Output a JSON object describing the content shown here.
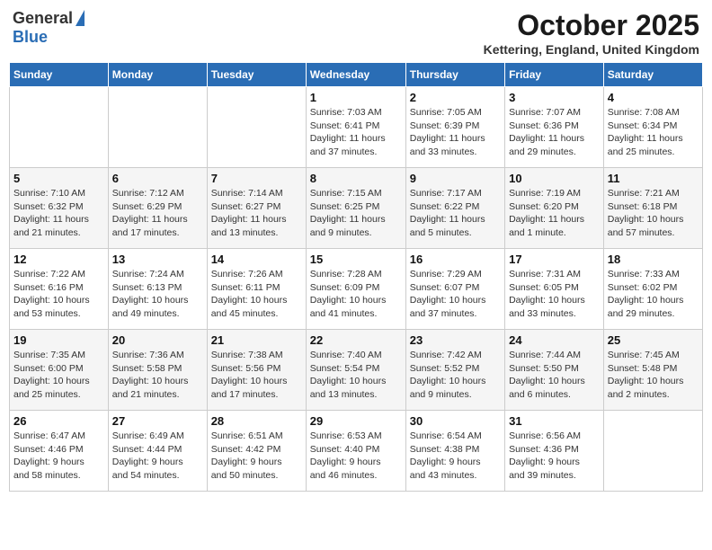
{
  "header": {
    "logo_general": "General",
    "logo_blue": "Blue",
    "month_title": "October 2025",
    "location": "Kettering, England, United Kingdom"
  },
  "weekdays": [
    "Sunday",
    "Monday",
    "Tuesday",
    "Wednesday",
    "Thursday",
    "Friday",
    "Saturday"
  ],
  "weeks": [
    [
      {
        "day": "",
        "info": ""
      },
      {
        "day": "",
        "info": ""
      },
      {
        "day": "",
        "info": ""
      },
      {
        "day": "1",
        "info": "Sunrise: 7:03 AM\nSunset: 6:41 PM\nDaylight: 11 hours\nand 37 minutes."
      },
      {
        "day": "2",
        "info": "Sunrise: 7:05 AM\nSunset: 6:39 PM\nDaylight: 11 hours\nand 33 minutes."
      },
      {
        "day": "3",
        "info": "Sunrise: 7:07 AM\nSunset: 6:36 PM\nDaylight: 11 hours\nand 29 minutes."
      },
      {
        "day": "4",
        "info": "Sunrise: 7:08 AM\nSunset: 6:34 PM\nDaylight: 11 hours\nand 25 minutes."
      }
    ],
    [
      {
        "day": "5",
        "info": "Sunrise: 7:10 AM\nSunset: 6:32 PM\nDaylight: 11 hours\nand 21 minutes."
      },
      {
        "day": "6",
        "info": "Sunrise: 7:12 AM\nSunset: 6:29 PM\nDaylight: 11 hours\nand 17 minutes."
      },
      {
        "day": "7",
        "info": "Sunrise: 7:14 AM\nSunset: 6:27 PM\nDaylight: 11 hours\nand 13 minutes."
      },
      {
        "day": "8",
        "info": "Sunrise: 7:15 AM\nSunset: 6:25 PM\nDaylight: 11 hours\nand 9 minutes."
      },
      {
        "day": "9",
        "info": "Sunrise: 7:17 AM\nSunset: 6:22 PM\nDaylight: 11 hours\nand 5 minutes."
      },
      {
        "day": "10",
        "info": "Sunrise: 7:19 AM\nSunset: 6:20 PM\nDaylight: 11 hours\nand 1 minute."
      },
      {
        "day": "11",
        "info": "Sunrise: 7:21 AM\nSunset: 6:18 PM\nDaylight: 10 hours\nand 57 minutes."
      }
    ],
    [
      {
        "day": "12",
        "info": "Sunrise: 7:22 AM\nSunset: 6:16 PM\nDaylight: 10 hours\nand 53 minutes."
      },
      {
        "day": "13",
        "info": "Sunrise: 7:24 AM\nSunset: 6:13 PM\nDaylight: 10 hours\nand 49 minutes."
      },
      {
        "day": "14",
        "info": "Sunrise: 7:26 AM\nSunset: 6:11 PM\nDaylight: 10 hours\nand 45 minutes."
      },
      {
        "day": "15",
        "info": "Sunrise: 7:28 AM\nSunset: 6:09 PM\nDaylight: 10 hours\nand 41 minutes."
      },
      {
        "day": "16",
        "info": "Sunrise: 7:29 AM\nSunset: 6:07 PM\nDaylight: 10 hours\nand 37 minutes."
      },
      {
        "day": "17",
        "info": "Sunrise: 7:31 AM\nSunset: 6:05 PM\nDaylight: 10 hours\nand 33 minutes."
      },
      {
        "day": "18",
        "info": "Sunrise: 7:33 AM\nSunset: 6:02 PM\nDaylight: 10 hours\nand 29 minutes."
      }
    ],
    [
      {
        "day": "19",
        "info": "Sunrise: 7:35 AM\nSunset: 6:00 PM\nDaylight: 10 hours\nand 25 minutes."
      },
      {
        "day": "20",
        "info": "Sunrise: 7:36 AM\nSunset: 5:58 PM\nDaylight: 10 hours\nand 21 minutes."
      },
      {
        "day": "21",
        "info": "Sunrise: 7:38 AM\nSunset: 5:56 PM\nDaylight: 10 hours\nand 17 minutes."
      },
      {
        "day": "22",
        "info": "Sunrise: 7:40 AM\nSunset: 5:54 PM\nDaylight: 10 hours\nand 13 minutes."
      },
      {
        "day": "23",
        "info": "Sunrise: 7:42 AM\nSunset: 5:52 PM\nDaylight: 10 hours\nand 9 minutes."
      },
      {
        "day": "24",
        "info": "Sunrise: 7:44 AM\nSunset: 5:50 PM\nDaylight: 10 hours\nand 6 minutes."
      },
      {
        "day": "25",
        "info": "Sunrise: 7:45 AM\nSunset: 5:48 PM\nDaylight: 10 hours\nand 2 minutes."
      }
    ],
    [
      {
        "day": "26",
        "info": "Sunrise: 6:47 AM\nSunset: 4:46 PM\nDaylight: 9 hours\nand 58 minutes."
      },
      {
        "day": "27",
        "info": "Sunrise: 6:49 AM\nSunset: 4:44 PM\nDaylight: 9 hours\nand 54 minutes."
      },
      {
        "day": "28",
        "info": "Sunrise: 6:51 AM\nSunset: 4:42 PM\nDaylight: 9 hours\nand 50 minutes."
      },
      {
        "day": "29",
        "info": "Sunrise: 6:53 AM\nSunset: 4:40 PM\nDaylight: 9 hours\nand 46 minutes."
      },
      {
        "day": "30",
        "info": "Sunrise: 6:54 AM\nSunset: 4:38 PM\nDaylight: 9 hours\nand 43 minutes."
      },
      {
        "day": "31",
        "info": "Sunrise: 6:56 AM\nSunset: 4:36 PM\nDaylight: 9 hours\nand 39 minutes."
      },
      {
        "day": "",
        "info": ""
      }
    ]
  ]
}
